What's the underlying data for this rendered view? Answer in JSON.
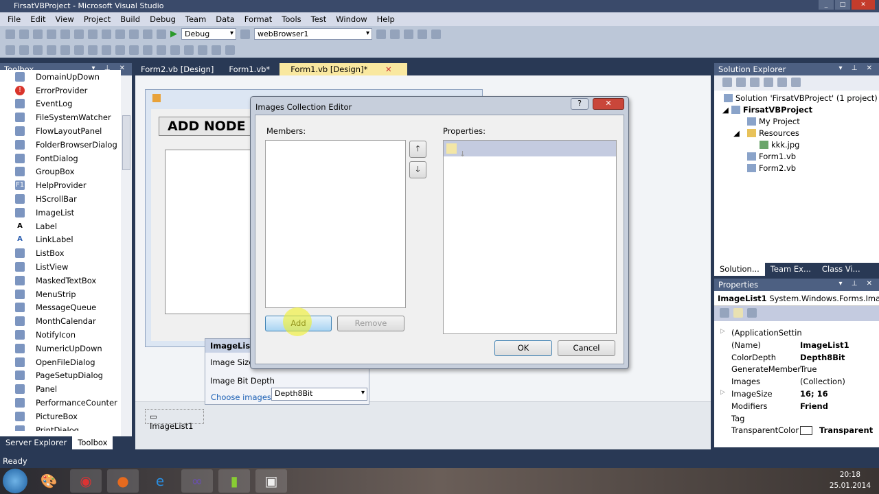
{
  "window": {
    "title": "FirsatVBProject - Microsoft Visual Studio"
  },
  "menu": [
    "File",
    "Edit",
    "View",
    "Project",
    "Build",
    "Debug",
    "Team",
    "Data",
    "Format",
    "Tools",
    "Test",
    "Window",
    "Help"
  ],
  "toolbar": {
    "config": "Debug",
    "target": "webBrowser1"
  },
  "toolbox": {
    "title": "Toolbox",
    "items": [
      "DomainUpDown",
      "ErrorProvider",
      "EventLog",
      "FileSystemWatcher",
      "FlowLayoutPanel",
      "FolderBrowserDialog",
      "FontDialog",
      "GroupBox",
      "HelpProvider",
      "HScrollBar",
      "ImageList",
      "Label",
      "LinkLabel",
      "ListBox",
      "ListView",
      "MaskedTextBox",
      "MenuStrip",
      "MessageQueue",
      "MonthCalendar",
      "NotifyIcon",
      "NumericUpDown",
      "OpenFileDialog",
      "PageSetupDialog",
      "Panel",
      "PerformanceCounter",
      "PictureBox",
      "PrintDialog"
    ],
    "tabs": [
      "Server Explorer",
      "Toolbox"
    ]
  },
  "doc_tabs": [
    "Form2.vb [Design]",
    "Form1.vb*",
    "Form1.vb [Design]*"
  ],
  "form": {
    "button": "ADD NODE"
  },
  "smart_tag": {
    "title": "ImageList Tasks",
    "image_size_label": "Image Size",
    "bit_depth_label": "Image Bit Depth",
    "bit_depth_value": "Depth8Bit",
    "choose_link": "Choose images"
  },
  "tray": {
    "component": "ImageList1"
  },
  "dialog": {
    "title": "Images Collection Editor",
    "members_label": "Members:",
    "properties_label": "Properties:",
    "add": "Add",
    "remove": "Remove",
    "ok": "OK",
    "cancel": "Cancel",
    "help": "?"
  },
  "solution_explorer": {
    "title": "Solution Explorer",
    "solution": "Solution 'FirsatVBProject' (1 project)",
    "project": "FirsatVBProject",
    "items": [
      "My Project",
      "Resources",
      "kkk.jpg",
      "Form1.vb",
      "Form2.vb"
    ],
    "tabs": [
      "Solution...",
      "Team Ex...",
      "Class Vi..."
    ]
  },
  "properties": {
    "title": "Properties",
    "object": "ImageList1",
    "type": "System.Windows.Forms.ImageL",
    "rows": [
      {
        "name": "(ApplicationSettin",
        "value": ""
      },
      {
        "name": "(Name)",
        "value": "ImageList1"
      },
      {
        "name": "ColorDepth",
        "value": "Depth8Bit"
      },
      {
        "name": "GenerateMember",
        "value": "True"
      },
      {
        "name": "Images",
        "value": "(Collection)"
      },
      {
        "name": "ImageSize",
        "value": "16; 16"
      },
      {
        "name": "Modifiers",
        "value": "Friend"
      },
      {
        "name": "Tag",
        "value": ""
      },
      {
        "name": "TransparentColor",
        "value": "Transparent"
      }
    ]
  },
  "status": "Ready",
  "clock": {
    "time": "20:18",
    "date": "25.01.2014"
  }
}
